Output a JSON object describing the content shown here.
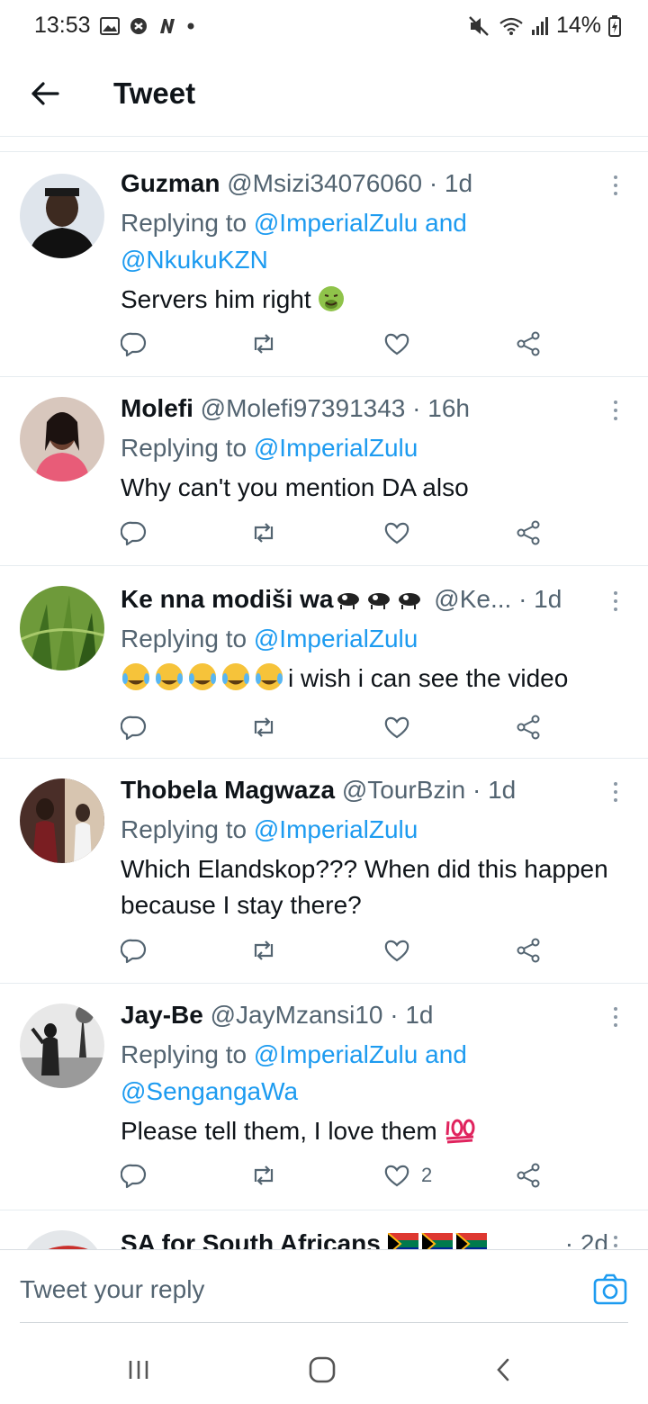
{
  "status_bar": {
    "time": "13:53",
    "battery": "14%",
    "icons": [
      "gallery-icon",
      "shield-icon",
      "n-icon",
      "dot-icon",
      "mute-icon",
      "wifi-icon",
      "signal-icon",
      "battery-icon"
    ]
  },
  "header": {
    "title": "Tweet",
    "back_icon": "arrow-left-icon"
  },
  "tweets": [
    {
      "name": "Guzman",
      "handle": "@Msizi34076060",
      "time": "· 1d",
      "replying_prefix": "Replying to",
      "mentions": "@ImperialZulu and @NkukuKZN",
      "text": "Servers him right",
      "emoji": "nauseated-face",
      "likes": ""
    },
    {
      "name": "Molefi",
      "handle": "@Molefi97391343",
      "time": "· 16h",
      "replying_prefix": "Replying to",
      "mentions": "@ImperialZulu",
      "text": "Why can't you mention DA also",
      "likes": ""
    },
    {
      "name": "Ke nna modiši wa",
      "handle": "@Ke...",
      "time": "· 1d",
      "replying_prefix": "Replying to",
      "mentions": "@ImperialZulu",
      "text": "i wish i can see the video",
      "emoji": "tears-of-joy-x5",
      "likes": ""
    },
    {
      "name": "Thobela Magwaza",
      "handle": "@TourBzin",
      "time": "· 1d",
      "replying_prefix": "Replying to",
      "mentions": "@ImperialZulu",
      "text": "Which Elandskop??? When did this happen because I stay there?",
      "likes": ""
    },
    {
      "name": "Jay-Be",
      "handle": "@JayMzansi10",
      "time": "· 1d",
      "replying_prefix": "Replying to",
      "mentions": "@ImperialZulu and @SengangaWa",
      "text": "Please tell them, I love them",
      "emoji": "hundred-points",
      "likes": "2"
    },
    {
      "name": "SA for South Africans",
      "handle": "",
      "time": "· 2d",
      "emoji": "south-africa-flags-x3"
    }
  ],
  "reply_bar": {
    "placeholder": "Tweet your reply",
    "camera_icon": "camera-icon"
  },
  "nav_bar": {
    "icons": [
      "recents-icon",
      "home-icon",
      "back-icon"
    ]
  },
  "colors": {
    "accent": "#1d9bf0",
    "text": "#0f1419",
    "secondary": "#536471",
    "divider": "#e6ecf0"
  }
}
